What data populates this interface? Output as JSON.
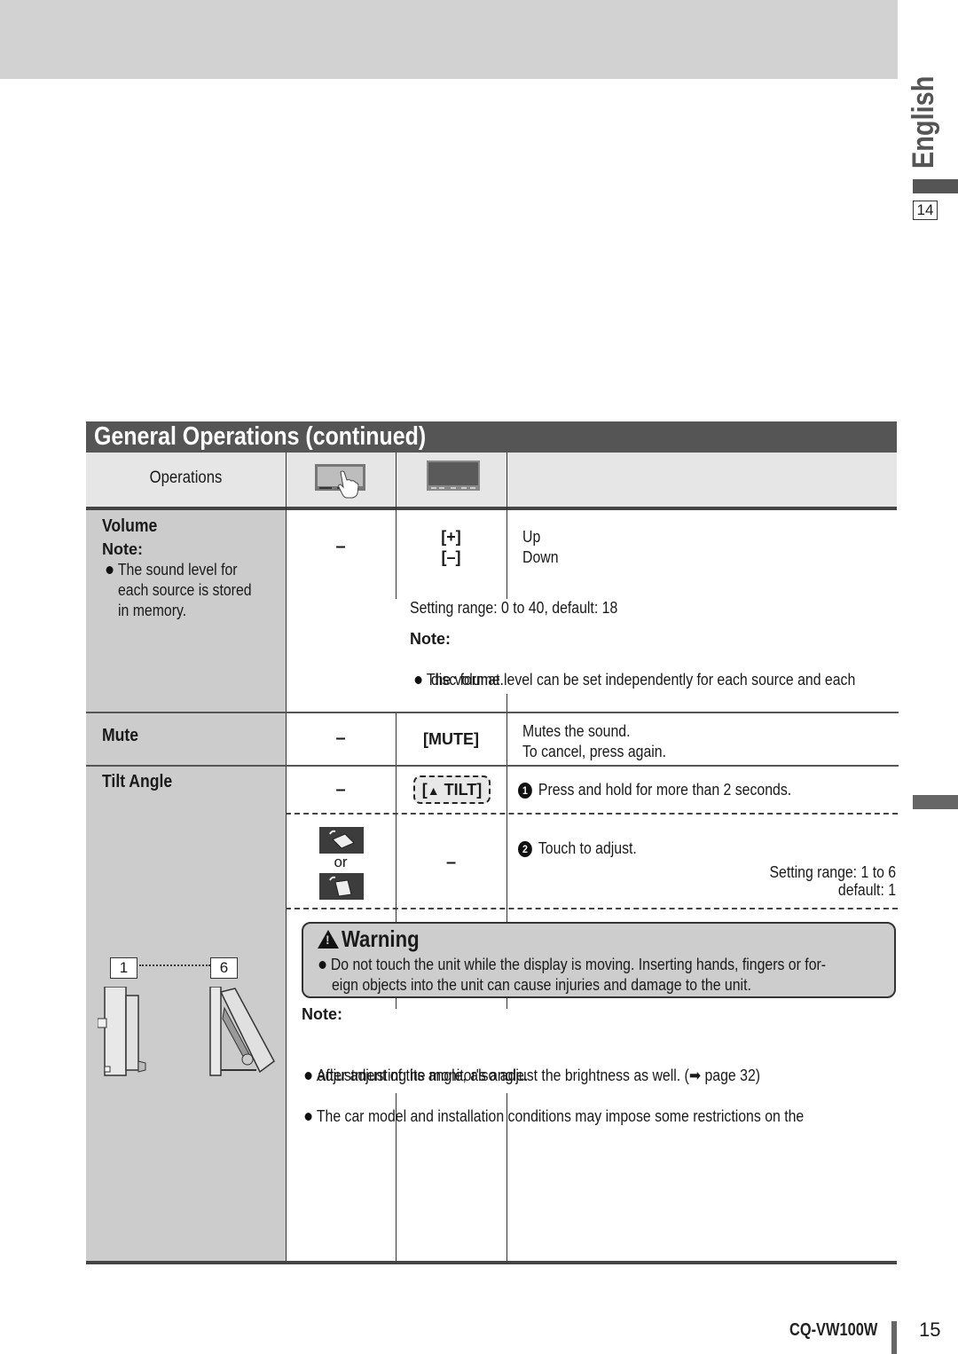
{
  "side_tab": {
    "language": "English",
    "page_ref": "14"
  },
  "section": {
    "title": "General Operations (continued)"
  },
  "header": {
    "operations_label": "Operations",
    "col_touch_icon": "touch-panel-icon",
    "col_unit_icon": "unit-panel-icon"
  },
  "rows": {
    "volume": {
      "title": "Volume",
      "note_label": "Note:",
      "note_lines": [
        "The sound level for",
        "each source is stored",
        "in memory."
      ],
      "touch": "–",
      "buttons": [
        "[+]",
        "[–]"
      ],
      "actions": [
        "Up",
        "Down"
      ],
      "range": "Setting range: 0 to 40,  default: 18",
      "note2_label": "Note:",
      "note2_lines": [
        "The volume level can be set independently for each source and each",
        "disc format."
      ]
    },
    "mute": {
      "title": "Mute",
      "touch": "–",
      "button": "[MUTE]",
      "desc": [
        "Mutes the sound.",
        "To cancel, press again."
      ]
    },
    "tilt": {
      "title": "Tilt Angle",
      "touch": "–",
      "button": "TILT",
      "step1_num": "1",
      "step1": "Press and hold for more than 2 seconds.",
      "touch_or": "or",
      "unit": "–",
      "step2_num": "2",
      "step2": "Touch to adjust.",
      "range": "Setting range: 1 to 6",
      "default": "default: 1",
      "angle_min": "1",
      "angle_max": "6"
    }
  },
  "warning": {
    "title": "Warning",
    "lines": [
      "Do not touch the unit while the display is moving. Inserting hands, fingers or for-",
      "eign objects into the unit can cause injuries and damage to the unit."
    ]
  },
  "tilt_note": {
    "label": "Note:",
    "items": [
      {
        "lines": [
          "After adjusting its angle, also adjust the brightness as well. (➡ page 32)"
        ]
      },
      {
        "lines": [
          "The car model and installation conditions may impose some restrictions on the",
          "adjustment of the monitor's angle."
        ]
      }
    ]
  },
  "footer": {
    "model": "CQ-VW100W",
    "page": "15"
  }
}
